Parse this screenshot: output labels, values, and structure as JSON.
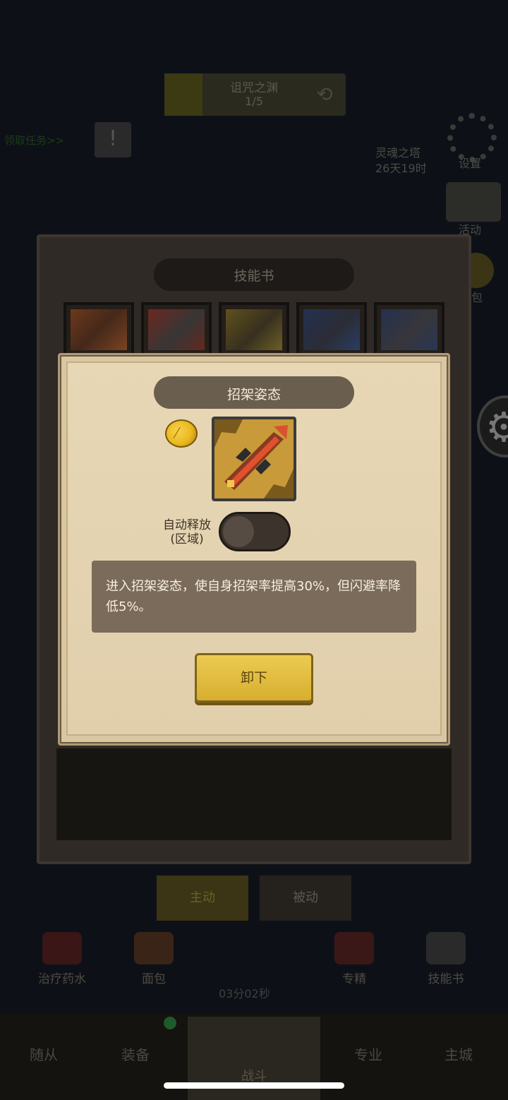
{
  "background": {
    "banner": {
      "title": "诅咒之渊",
      "progress": "1/5"
    },
    "left_task": "领取任务>>",
    "event": {
      "name": "灵魂之塔",
      "remaining": "26天19时"
    },
    "right_menu": {
      "settings": "设置",
      "activity": "活动",
      "pack": "包"
    },
    "skill_book_title": "技能书",
    "tabs": {
      "active": "主动",
      "passive": "被动"
    },
    "items": [
      {
        "label": "治疗药水"
      },
      {
        "label": "面包"
      },
      {
        "label": "专精"
      },
      {
        "label": "技能书"
      }
    ],
    "timer": "03分02秒",
    "nav": {
      "follower": "随从",
      "equipment": "装备",
      "battle": "战斗",
      "profession": "专业",
      "main_city": "主城"
    }
  },
  "modal": {
    "title": "招架姿态",
    "auto_cast_label_line1": "自动释放",
    "auto_cast_label_line2": "(区域)",
    "auto_cast_enabled": false,
    "description": "进入招架姿态，使自身招架率提高30%，但闪避率降低5%。",
    "unequip_button": "卸下"
  },
  "colors": {
    "modal_parchment": "#e3d1ae",
    "title_bar": "#6a5e4f",
    "button_gold": "#e2be42",
    "desc_box": "#7b6b5a"
  }
}
